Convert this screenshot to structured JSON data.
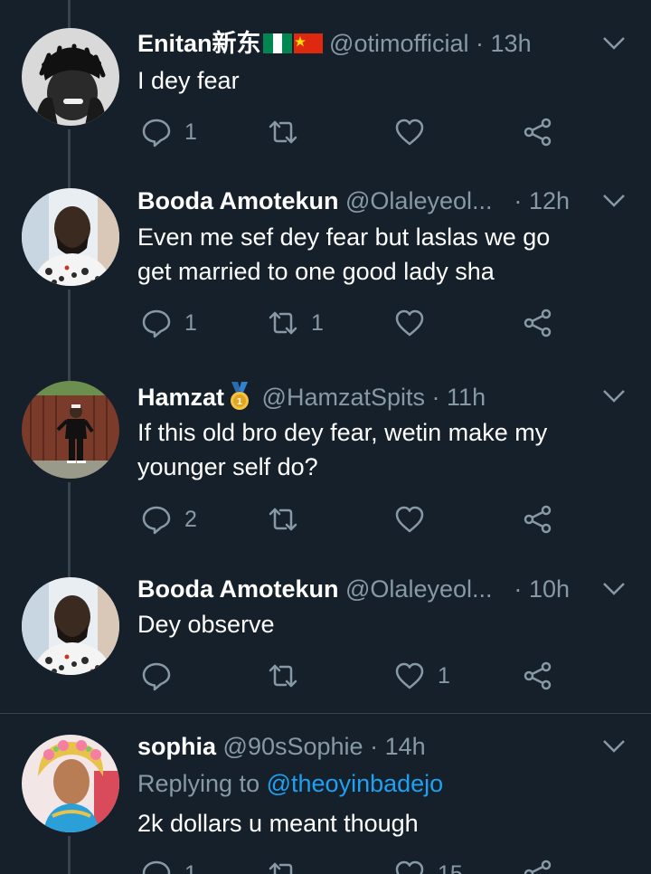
{
  "tweets": [
    {
      "name": "Enitan新东",
      "handle": "@otimofficial",
      "time": "13h",
      "text_lines": [
        "I dey fear"
      ],
      "replies": "1",
      "retweets": "",
      "likes": "",
      "flags": [
        "nigeria-flag-icon",
        "china-flag-icon"
      ]
    },
    {
      "name": "Booda Amotekun",
      "handle": "@Olaleyeol...",
      "time": "12h",
      "text_lines": [
        "Even me sef dey fear but laslas we go",
        "get married to one good lady sha"
      ],
      "replies": "1",
      "retweets": "1",
      "likes": ""
    },
    {
      "name": "Hamzat",
      "handle": "@HamzatSpits",
      "time": "11h",
      "text_lines": [
        "If this old bro dey fear, wetin make my",
        "younger self do?"
      ],
      "replies": "2",
      "retweets": "",
      "likes": "",
      "badge": "gold-medal-icon"
    },
    {
      "name": "Booda Amotekun",
      "handle": "@Olaleyeol...",
      "time": "10h",
      "text_lines": [
        "Dey observe"
      ],
      "replies": "",
      "retweets": "",
      "likes": "1"
    },
    {
      "name": "sophia",
      "handle": "@90sSophie",
      "time": "14h",
      "replying_prefix": "Replying to",
      "replying_handle": "@theoyinbadejo",
      "text_lines": [
        "2k dollars u meant though"
      ],
      "replies": "1",
      "retweets": "",
      "likes": "15"
    }
  ],
  "separator_dot": "·",
  "icons": {
    "reply": "reply-icon",
    "retweet": "retweet-icon",
    "like": "heart-icon",
    "share": "share-icon",
    "menu": "chevron-down-icon"
  },
  "colors": {
    "background": "#15202b",
    "secondary_text": "#8899a6",
    "link": "#1da1f2",
    "divider": "#38444d"
  }
}
